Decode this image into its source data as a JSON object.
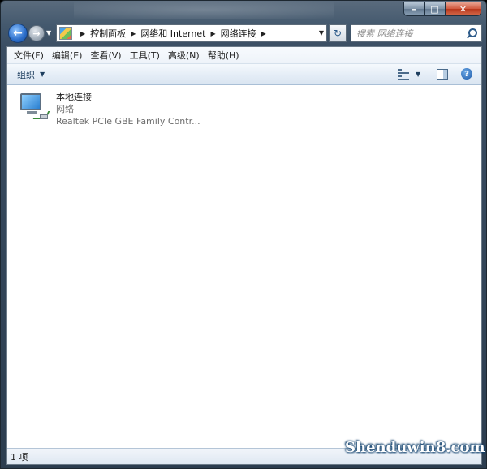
{
  "address": {
    "crumbs": [
      "控制面板",
      "网络和 Internet",
      "网络连接"
    ]
  },
  "search": {
    "placeholder": "搜索 网络连接"
  },
  "menubar": {
    "items": [
      "文件(F)",
      "编辑(E)",
      "查看(V)",
      "工具(T)",
      "高级(N)",
      "帮助(H)"
    ]
  },
  "toolbar": {
    "organize_label": "组织"
  },
  "connections": [
    {
      "name": "本地连接",
      "status": "网络",
      "device": "Realtek PCIe GBE Family Contr..."
    }
  ],
  "statusbar": {
    "count": "1 项"
  },
  "watermark": {
    "text": "Shenduwin8.com"
  },
  "icons": {
    "back": "back-arrow-icon",
    "forward": "forward-arrow-icon",
    "refresh": "refresh-icon",
    "search": "search-icon",
    "help": "help-icon",
    "connection": "network-adapter-icon"
  }
}
